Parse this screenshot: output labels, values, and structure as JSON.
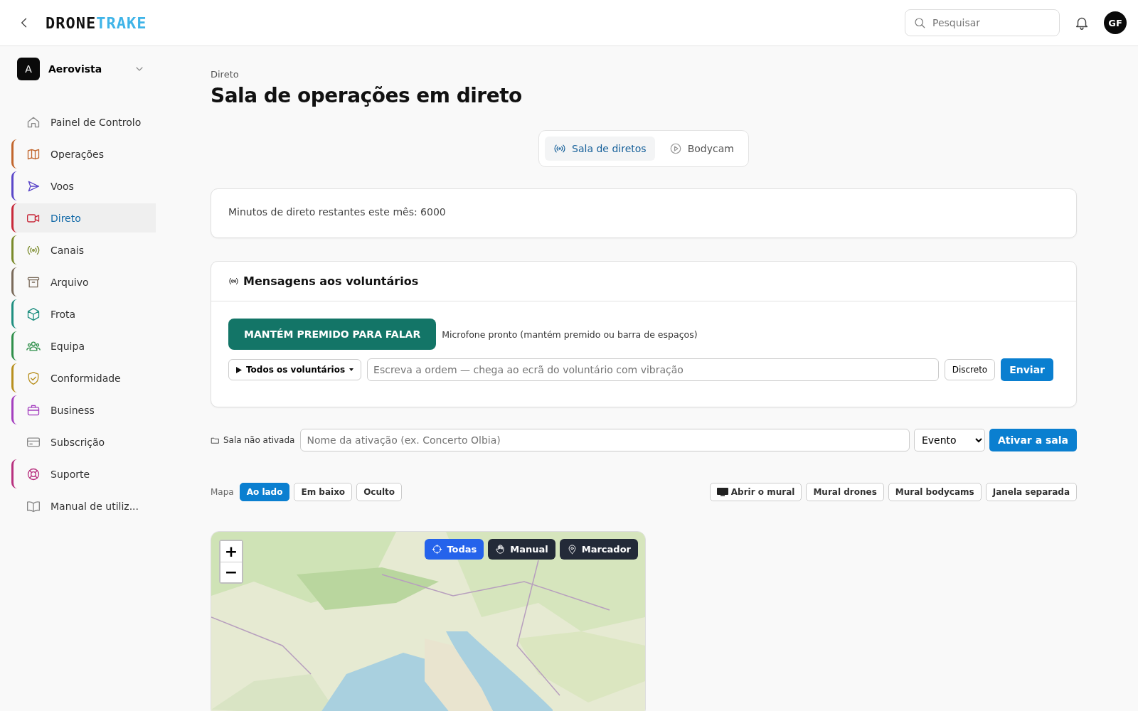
{
  "header": {
    "logo_dark": "DRONE",
    "logo_light": "TRAKE",
    "search": {
      "placeholder": "Pesquisar"
    },
    "avatar": "GF"
  },
  "org": {
    "initial": "A",
    "name": "Aerovista"
  },
  "sidebar": {
    "items": [
      {
        "label": "Painel de Controlo",
        "selected": false
      },
      {
        "label": "Operações",
        "selected": false,
        "color": "#c2662d"
      },
      {
        "label": "Voos",
        "selected": false,
        "color": "#5b47c9"
      },
      {
        "label": "Direto",
        "selected": true,
        "color": "#c8293a"
      },
      {
        "label": "Canais",
        "selected": false,
        "color": "#7a8a2a"
      },
      {
        "label": "Arquivo",
        "selected": false,
        "color": "#7a6a5a"
      },
      {
        "label": "Frota",
        "selected": false,
        "color": "#1f8f80"
      },
      {
        "label": "Equipa",
        "selected": false,
        "color": "#2f8f4a"
      },
      {
        "label": "Conformidade",
        "selected": false,
        "color": "#b8901f"
      },
      {
        "label": "Business",
        "selected": false,
        "color": "#a43fbf"
      },
      {
        "label": "Subscrição",
        "selected": false
      },
      {
        "label": "Suporte",
        "selected": false,
        "color": "#b8317f"
      },
      {
        "label": "Manual de utiliz..."
      }
    ]
  },
  "breadcrumb": "Direto",
  "title": "Sala de operações em direto",
  "tabs": [
    {
      "label": "Sala de diretos",
      "selected": true
    },
    {
      "label": "Bodycam",
      "selected": false
    }
  ],
  "minutes": "Minutos de direto restantes este mês: 6000",
  "messages": {
    "title": "Mensagens aos voluntários",
    "talk_button": "MANTÉM PREMIDO PARA FALAR",
    "mic_status": "Microfone pronto (mantém premido ou barra de espaços)",
    "recipients": "Todos os voluntários",
    "order": {
      "placeholder": "Escreva a ordem — chega ao ecrã do voluntário com vibração"
    },
    "discreet": "Discreto",
    "send": "Enviar"
  },
  "room": {
    "status": "Sala não ativada",
    "name": {
      "placeholder": "Nome da ativação (ex. Concerto Olbia)"
    },
    "type": "Evento",
    "activate": "Ativar a sala"
  },
  "map_bar": {
    "label": "Mapa",
    "modes": [
      {
        "label": "Ao lado",
        "selected": true
      },
      {
        "label": "Em baixo",
        "selected": false
      },
      {
        "label": "Oculto",
        "selected": false
      }
    ],
    "actions": [
      {
        "label": "Abrir o mural",
        "kind": "monitor"
      },
      {
        "label": "Mural drones",
        "kind": "plain"
      },
      {
        "label": "Mural bodycams",
        "kind": "plain"
      },
      {
        "label": "Janela separada",
        "kind": "plain"
      }
    ]
  },
  "map": {
    "kind": "picture",
    "zoom_in": "+",
    "zoom_out": "−",
    "filters": [
      {
        "label": "Todas",
        "selected": true
      },
      {
        "label": "Manual",
        "selected": false
      },
      {
        "label": "Marcador",
        "selected": false
      }
    ]
  }
}
